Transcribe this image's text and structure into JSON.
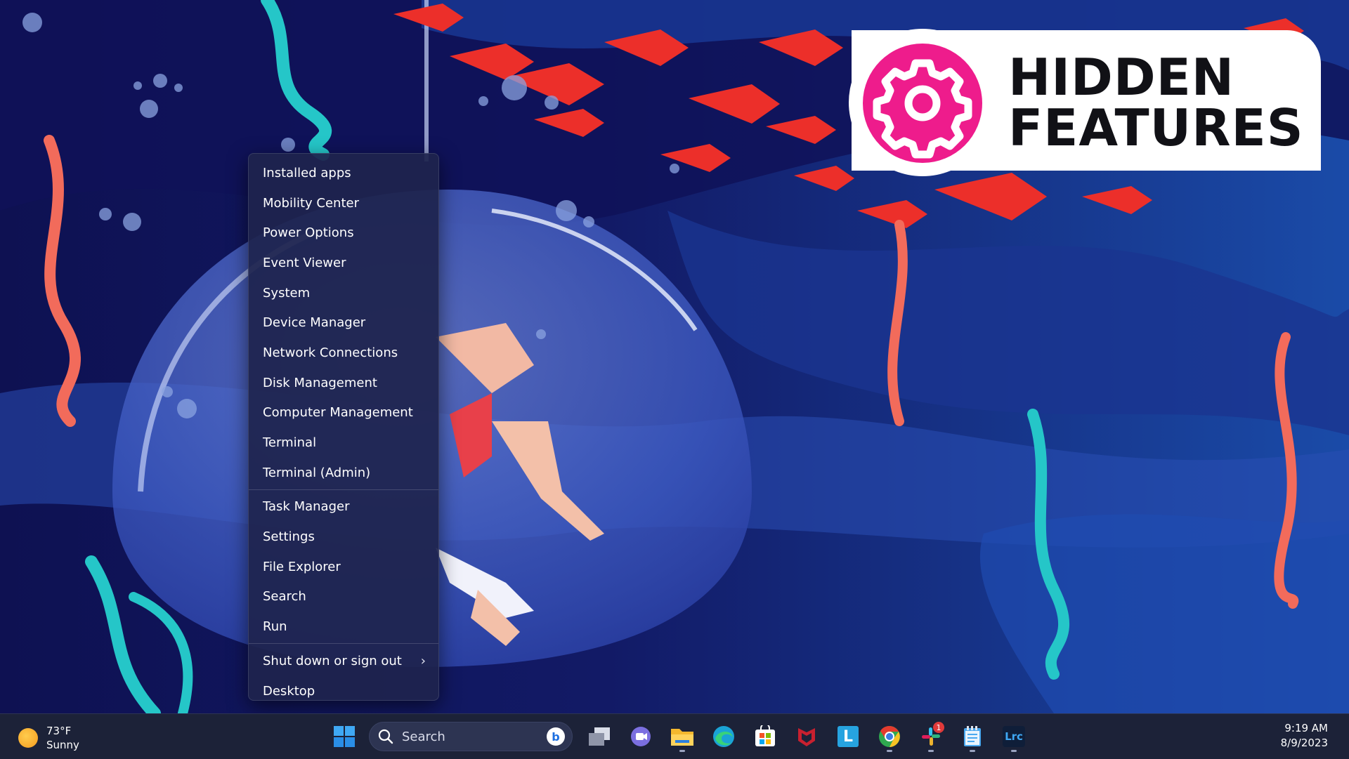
{
  "badge": {
    "line1": "HIDDEN",
    "line2": "FEATURES",
    "color": "#ee1c8c"
  },
  "menu": {
    "items": [
      "Installed apps",
      "Mobility Center",
      "Power Options",
      "Event Viewer",
      "System",
      "Device Manager",
      "Network Connections",
      "Disk Management",
      "Computer Management",
      "Terminal",
      "Terminal (Admin)",
      "Task Manager",
      "Settings",
      "File Explorer",
      "Search",
      "Run",
      "Shut down or sign out",
      "Desktop"
    ],
    "shutdown_chevron": "›"
  },
  "taskbar": {
    "weather": {
      "temp": "73°F",
      "condition": "Sunny"
    },
    "search": {
      "placeholder": "Search"
    },
    "apps": [
      "start-icon",
      "task-view-icon",
      "teams-chat-icon",
      "file-explorer-icon",
      "edge-icon",
      "store-icon",
      "mcafee-icon",
      "l-app-icon",
      "chrome-icon",
      "slack-icon",
      "notepad-icon",
      "lightroom-classic-icon"
    ],
    "slack_badge": "1",
    "lightroom_label": "Lrc",
    "l_app_label": "L",
    "clock": {
      "time": "9:19 AM",
      "date": "8/9/2023"
    }
  }
}
